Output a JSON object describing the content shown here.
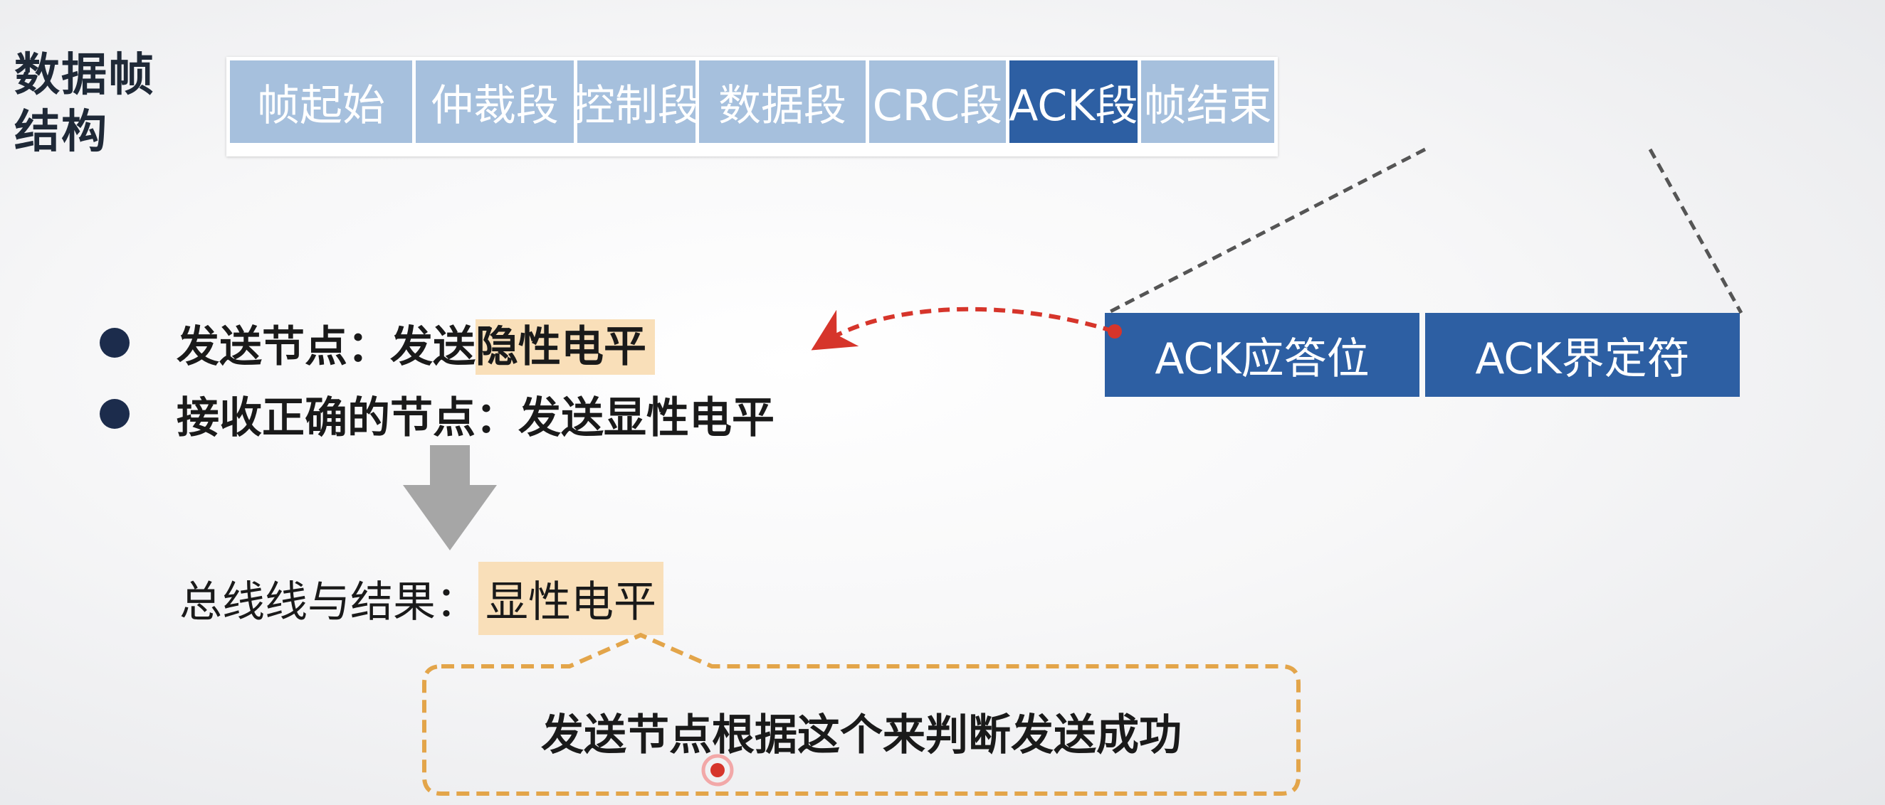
{
  "title": "数据帧结构",
  "frame_segments": [
    {
      "label": "帧起始"
    },
    {
      "label": "仲裁段"
    },
    {
      "label": "控制段"
    },
    {
      "label": "数据段"
    },
    {
      "label": "CRC段"
    },
    {
      "label": "ACK段"
    },
    {
      "label": "帧结束"
    }
  ],
  "ack_subfields": [
    {
      "label": "ACK应答位"
    },
    {
      "label": "ACK界定符"
    }
  ],
  "bullets": [
    {
      "prefix": "发送节点：发送",
      "highlight": "隐性电平"
    },
    {
      "text": "接收正确的节点：发送显性电平"
    }
  ],
  "result": {
    "label": "总线线与结果：",
    "value": "显性电平"
  },
  "callout": {
    "text": "发送节点根据这个来判断发送成功"
  },
  "colors": {
    "segment_light": "#a6c0dd",
    "segment_active": "#2d5fa3",
    "highlight": "#f9dfb9",
    "callout_border": "#e3a54a",
    "arrow_red": "#d6352b",
    "bullet_dot": "#1c2c4c"
  }
}
